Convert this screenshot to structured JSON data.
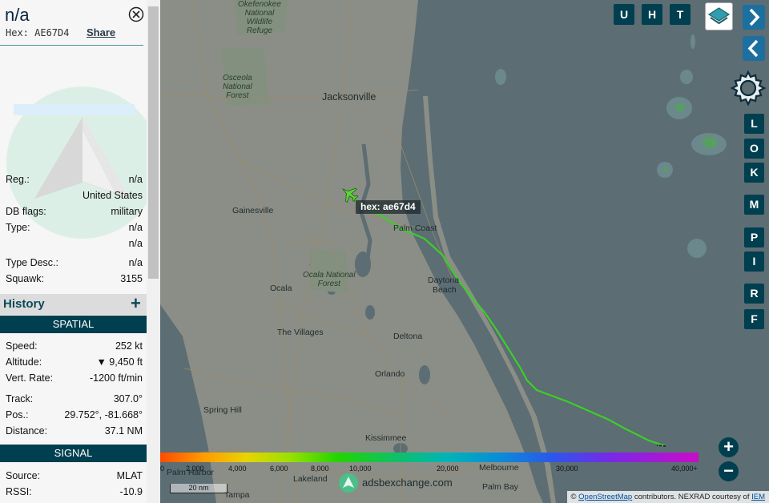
{
  "sidebar": {
    "callsign": "n/a",
    "hex_label": "Hex: AE67D4",
    "share": "Share",
    "details": [
      {
        "label": "Reg.:",
        "value": "n/a"
      },
      {
        "label": "",
        "value": "United States"
      },
      {
        "label": "DB flags:",
        "value": "military"
      },
      {
        "label": "Type:",
        "value": "n/a"
      },
      {
        "label": "",
        "value": "n/a"
      },
      {
        "label": "Type Desc.:",
        "value": "n/a"
      },
      {
        "label": "Squawk:",
        "value": "3155"
      }
    ],
    "history_title": "History",
    "history_plus": "+",
    "spatial_header": "SPATIAL",
    "spatial": [
      {
        "label": "Speed:",
        "value": "252 kt"
      },
      {
        "label": "Altitude:",
        "value": "▼ 9,450 ft"
      },
      {
        "label": "Vert. Rate:",
        "value": "-1200 ft/min"
      },
      {
        "label": "Track:",
        "value": "307.0°"
      },
      {
        "label": "Pos.:",
        "value": "29.752°, -81.668°"
      },
      {
        "label": "Distance:",
        "value": "37.1 NM"
      }
    ],
    "signal_header": "SIGNAL",
    "signal": [
      {
        "label": "Source:",
        "value": "MLAT"
      },
      {
        "label": "RSSI:",
        "value": "-10.9"
      }
    ]
  },
  "map": {
    "aircraft_tag": "hex: ae67d4",
    "top_buttons": [
      "U",
      "H",
      "T"
    ],
    "side_buttons": [
      "L",
      "O",
      "K",
      "M",
      "P",
      "I",
      "R",
      "F"
    ],
    "zoom_in": "+",
    "zoom_out": "−",
    "cities": [
      {
        "name": "Jacksonville",
        "kind": "big"
      },
      {
        "name": "Gainesville",
        "kind": "city"
      },
      {
        "name": "Palm Coast",
        "kind": "city"
      },
      {
        "name": "Daytona",
        "kind": "city"
      },
      {
        "name": "Beach",
        "kind": "city"
      },
      {
        "name": "Ocala",
        "kind": "city"
      },
      {
        "name": "The Villages",
        "kind": "city"
      },
      {
        "name": "Deltona",
        "kind": "city"
      },
      {
        "name": "Orlando",
        "kind": "city"
      },
      {
        "name": "Spring Hill",
        "kind": "city"
      },
      {
        "name": "Kissimmee",
        "kind": "city"
      },
      {
        "name": "Melbourne",
        "kind": "city"
      },
      {
        "name": "Palm Harbor",
        "kind": "city"
      },
      {
        "name": "Lakeland",
        "kind": "city"
      },
      {
        "name": "Palm Bay",
        "kind": "city"
      },
      {
        "name": "Tampa",
        "kind": "city"
      }
    ],
    "parks": [
      {
        "line1": "Okefenokee",
        "line2": "National",
        "line3": "Wildlife",
        "line4": "Refuge"
      },
      {
        "line1": "Osceola",
        "line2": "National",
        "line3": "Forest"
      },
      {
        "line1": "Ocala National",
        "line2": "Forest"
      }
    ],
    "altitude_legend": [
      "0",
      "2,000",
      "4,000",
      "6,000",
      "8,000",
      "10,000",
      "20,000",
      "30,000",
      "40,000+"
    ],
    "scale_label": "20 nm",
    "brand": "adsbexchange.com",
    "attribution_prefix": "©",
    "attribution_osm": "OpenStreetMap",
    "attribution_mid": "contributors. NEXRAD courtesy of",
    "attribution_iem": "IEM"
  },
  "colors": {
    "accent": "#003f4f",
    "track": "#3ccf28",
    "aircraft": "#5fd23a",
    "water": "#5c6d73",
    "land": "#8d9087"
  }
}
